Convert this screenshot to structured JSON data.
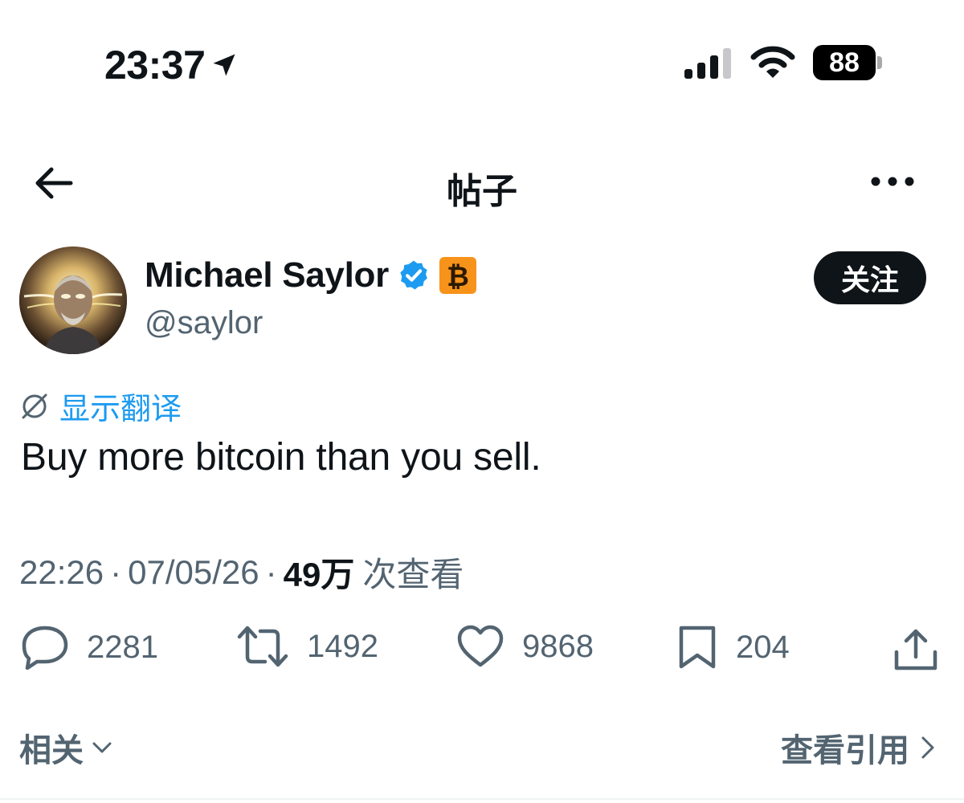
{
  "status_bar": {
    "time": "23:37",
    "battery": "88"
  },
  "nav": {
    "title": "帖子"
  },
  "author": {
    "name": "Michael Saylor",
    "handle": "@saylor",
    "follow_label": "关注",
    "badge_symbol": "₿"
  },
  "translate": {
    "label": "显示翻译"
  },
  "tweet": {
    "text": "Buy more bitcoin than you sell."
  },
  "meta": {
    "time": "22:26",
    "separator": "·",
    "date": "07/05/26",
    "views_count": "49万",
    "views_label": "次查看"
  },
  "actions": {
    "replies": "2281",
    "retweets": "1492",
    "likes": "9868",
    "bookmarks": "204"
  },
  "footer": {
    "related_label": "相关",
    "quotes_label": "查看引用"
  },
  "colors": {
    "accent": "#1d9bf0",
    "text": "#0f1419",
    "muted": "#536471",
    "bitcoin": "#f7931a"
  },
  "icons": {
    "location": "location-arrow-icon",
    "signal": "cellular-signal-icon",
    "wifi": "wifi-icon",
    "back": "arrow-left-icon",
    "more": "ellipsis-icon",
    "verified": "verified-badge-icon",
    "translate": "translate-icon",
    "reply": "reply-icon",
    "retweet": "retweet-icon",
    "like": "heart-icon",
    "bookmark": "bookmark-icon",
    "share": "share-icon"
  }
}
